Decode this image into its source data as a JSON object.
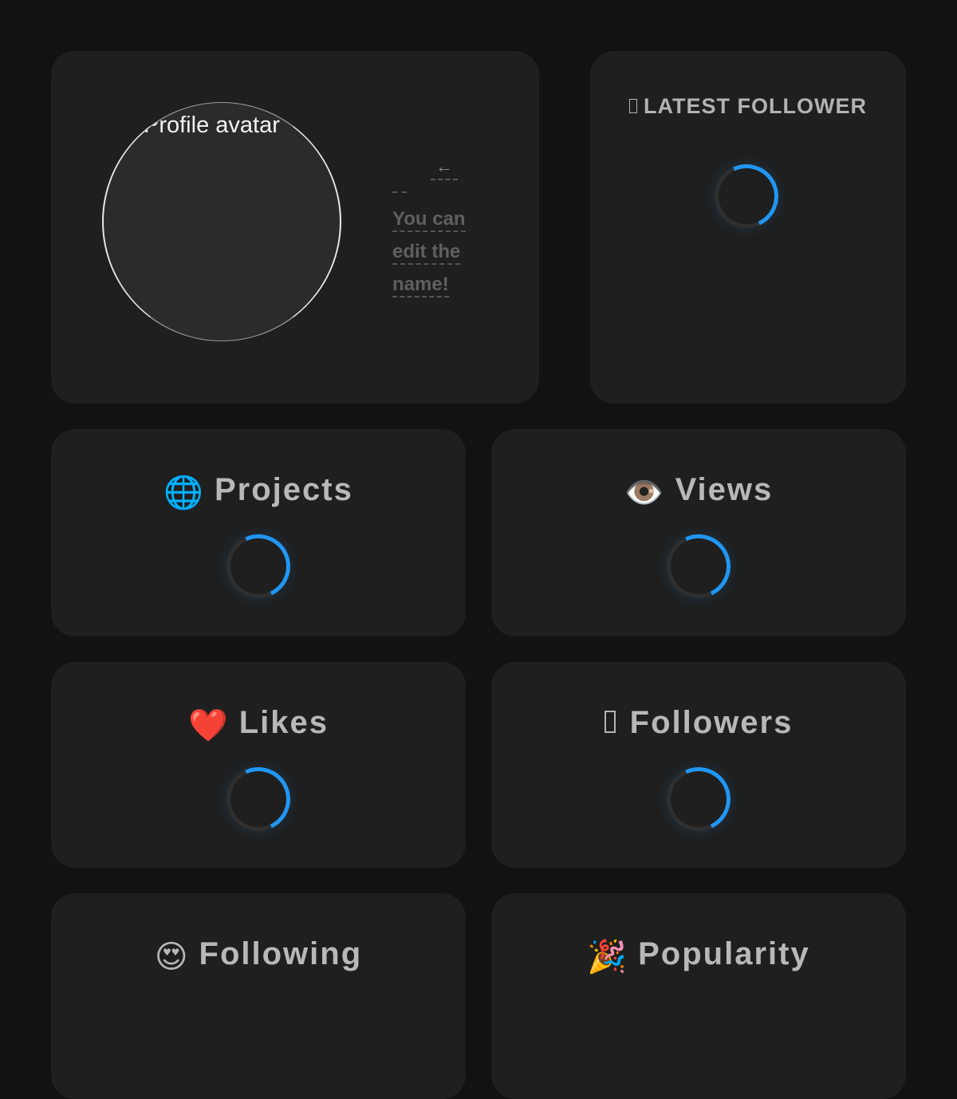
{
  "profile": {
    "avatar_alt": "Profile avatar",
    "arrow": "←",
    "hint_lines": [
      "You can",
      "edit the",
      "name!"
    ]
  },
  "latest_follower": {
    "title": "LATEST FOLLOWER",
    "icon": "missing-glyph-icon"
  },
  "stats": {
    "projects": {
      "emoji": "🌐",
      "label": "Projects"
    },
    "views": {
      "emoji": "👁️",
      "label": "Views"
    },
    "likes": {
      "emoji": "❤️",
      "label": "Likes"
    },
    "followers": {
      "icon": "missing-glyph-icon",
      "label": "Followers"
    },
    "following": {
      "emoji": "😍",
      "label": "Following"
    },
    "popularity": {
      "emoji": "🎉",
      "label": "Popularity"
    }
  },
  "colors": {
    "background": "#121212",
    "card": "#1f1f1f",
    "spinner_accent": "#2196f3",
    "label": "#b8b8b8"
  }
}
